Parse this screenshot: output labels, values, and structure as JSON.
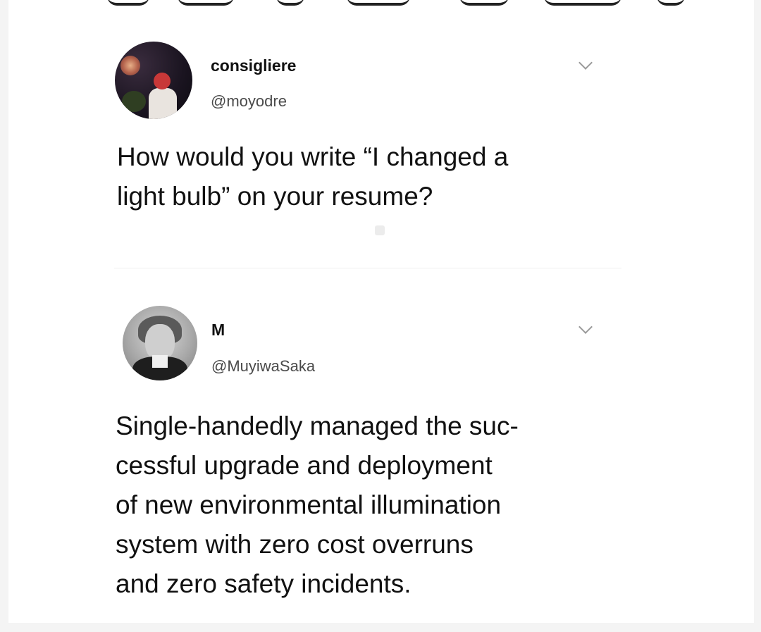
{
  "tweets": [
    {
      "display_name": "consigliere",
      "handle": "@moyodre",
      "text": "How would you write “I changed a\nlight bulb” on your resume?",
      "avatar_icon": "profile-avatar",
      "menu_icon": "chevron-down-icon"
    },
    {
      "display_name": "M",
      "handle": "@MuyiwaSaka",
      "text": "Single-handedly managed the suc-\ncessful upgrade and deployment\nof new environmental illumination\nsystem with zero cost overruns\nand zero safety incidents.",
      "avatar_icon": "profile-avatar",
      "menu_icon": "chevron-down-icon"
    }
  ],
  "colors": {
    "text": "#111111",
    "handle": "#4a4a4a",
    "background": "#ffffff",
    "chevron": "#9a9a9a"
  }
}
